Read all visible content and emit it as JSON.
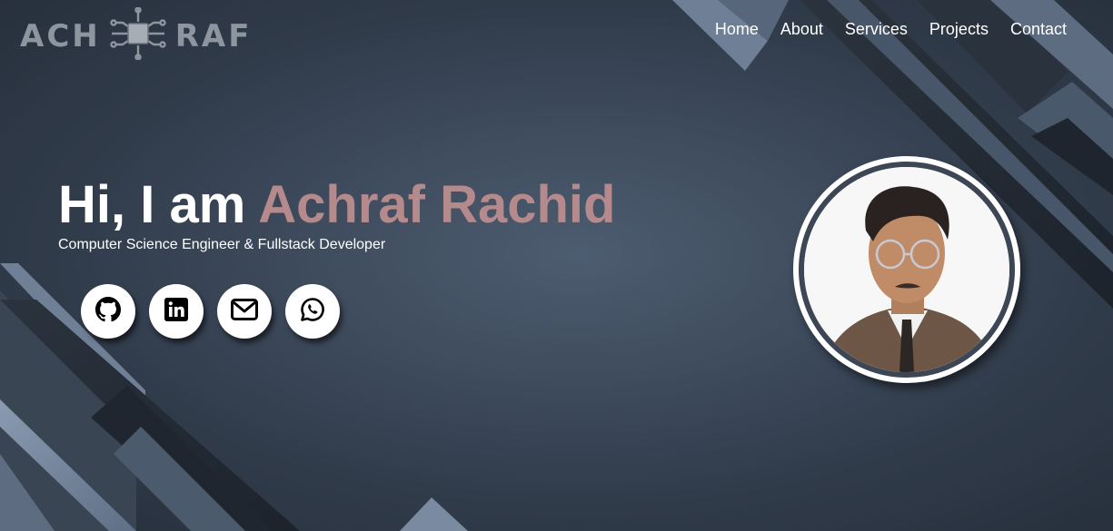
{
  "logo": {
    "left_text": "ACH",
    "right_text": "RAF",
    "icon": "circuit-chip-icon"
  },
  "nav": {
    "items": [
      "Home",
      "About",
      "Services",
      "Projects",
      "Contact"
    ]
  },
  "hero": {
    "greeting": "Hi, I am ",
    "name": "Achraf Rachid",
    "subtitle": "Computer Science Engineer & Fullstack Developer"
  },
  "socials": [
    {
      "name": "github",
      "icon": "github-icon"
    },
    {
      "name": "linkedin",
      "icon": "linkedin-icon"
    },
    {
      "name": "email",
      "icon": "envelope-icon"
    },
    {
      "name": "whatsapp",
      "icon": "whatsapp-icon"
    }
  ],
  "colors": {
    "background": "#3f4c5e",
    "accent_name": "#b58a8d",
    "text": "#ffffff",
    "logo": "#8d959f"
  }
}
